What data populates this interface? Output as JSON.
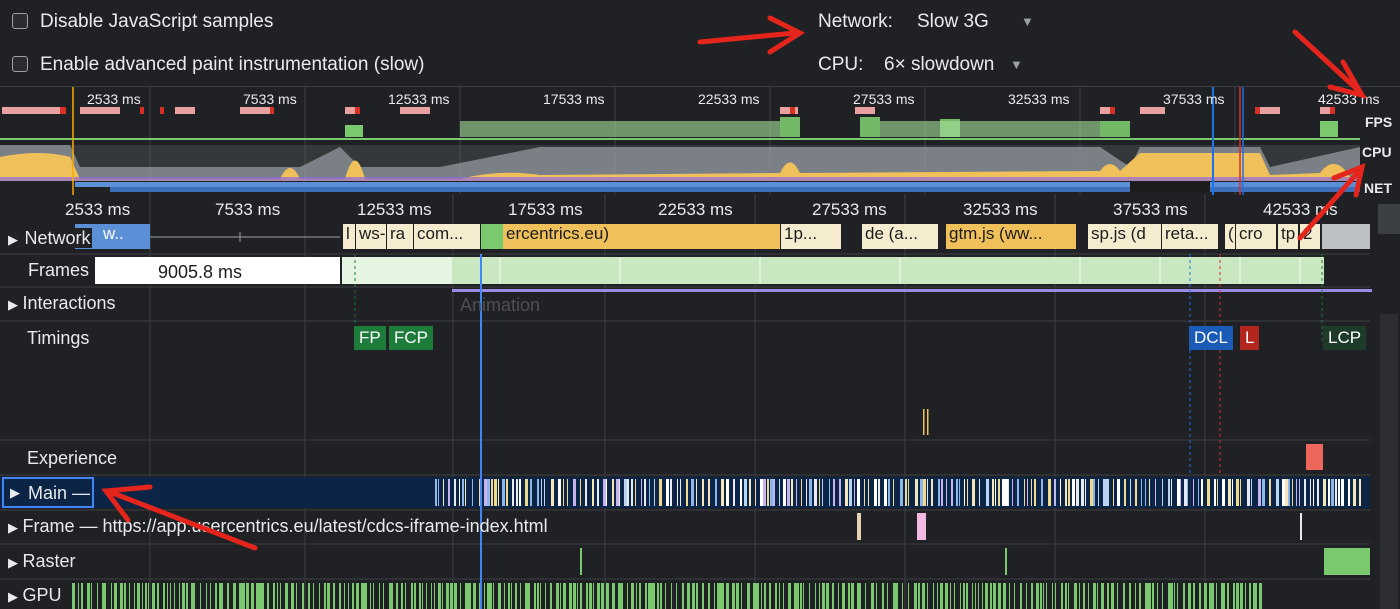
{
  "settings": {
    "disable_js_samples": "Disable JavaScript samples",
    "advanced_paint": "Enable advanced paint instrumentation (slow)",
    "network_label": "Network:",
    "network_value": "Slow 3G",
    "cpu_label": "CPU:",
    "cpu_value": "6× slowdown"
  },
  "overview": {
    "ticks": [
      "2533 ms",
      "7533 ms",
      "12533 ms",
      "17533 ms",
      "22533 ms",
      "27533 ms",
      "32533 ms",
      "37533 ms",
      "42533 ms"
    ],
    "fps": "FPS",
    "cpu": "CPU",
    "net": "NET"
  },
  "ruler": {
    "ticks": [
      "2533 ms",
      "7533 ms",
      "12533 ms",
      "17533 ms",
      "22533 ms",
      "27533 ms",
      "32533 ms",
      "37533 ms",
      "42533 ms"
    ]
  },
  "tracks": {
    "network": "Network",
    "frames": "Frames",
    "frames_value": "9005.8 ms",
    "interactions": "Interactions",
    "animation": "Animation",
    "timings": "Timings",
    "experience": "Experience",
    "main": "Main —",
    "frame": "Frame — https://app.usercentrics.eu/latest/cdcs-iframe-index.html",
    "raster": "Raster",
    "gpu": "GPU"
  },
  "network_segments": [
    "w..",
    "l",
    "ws-",
    "ra",
    "com...",
    "ercentrics.eu)",
    "1p...",
    "de (a...",
    "gtm.js (ww...",
    "sp.js (d",
    "reta...",
    "(",
    "cro",
    "tp",
    "2"
  ],
  "timing_markers": [
    "FP",
    "FCP",
    "DCL",
    "L",
    "LCP"
  ],
  "colors": {
    "background": "#202124",
    "fps_green": "#7bc96f",
    "cpu_yellow": "#f0c05a",
    "net_blue": "#5b8fd6",
    "main_bg": "#0c2547",
    "fp_green": "#1e7c3a",
    "dcl_blue": "#1a5bb8",
    "load_red": "#b3261e",
    "annotation_red": "#e5251b"
  }
}
